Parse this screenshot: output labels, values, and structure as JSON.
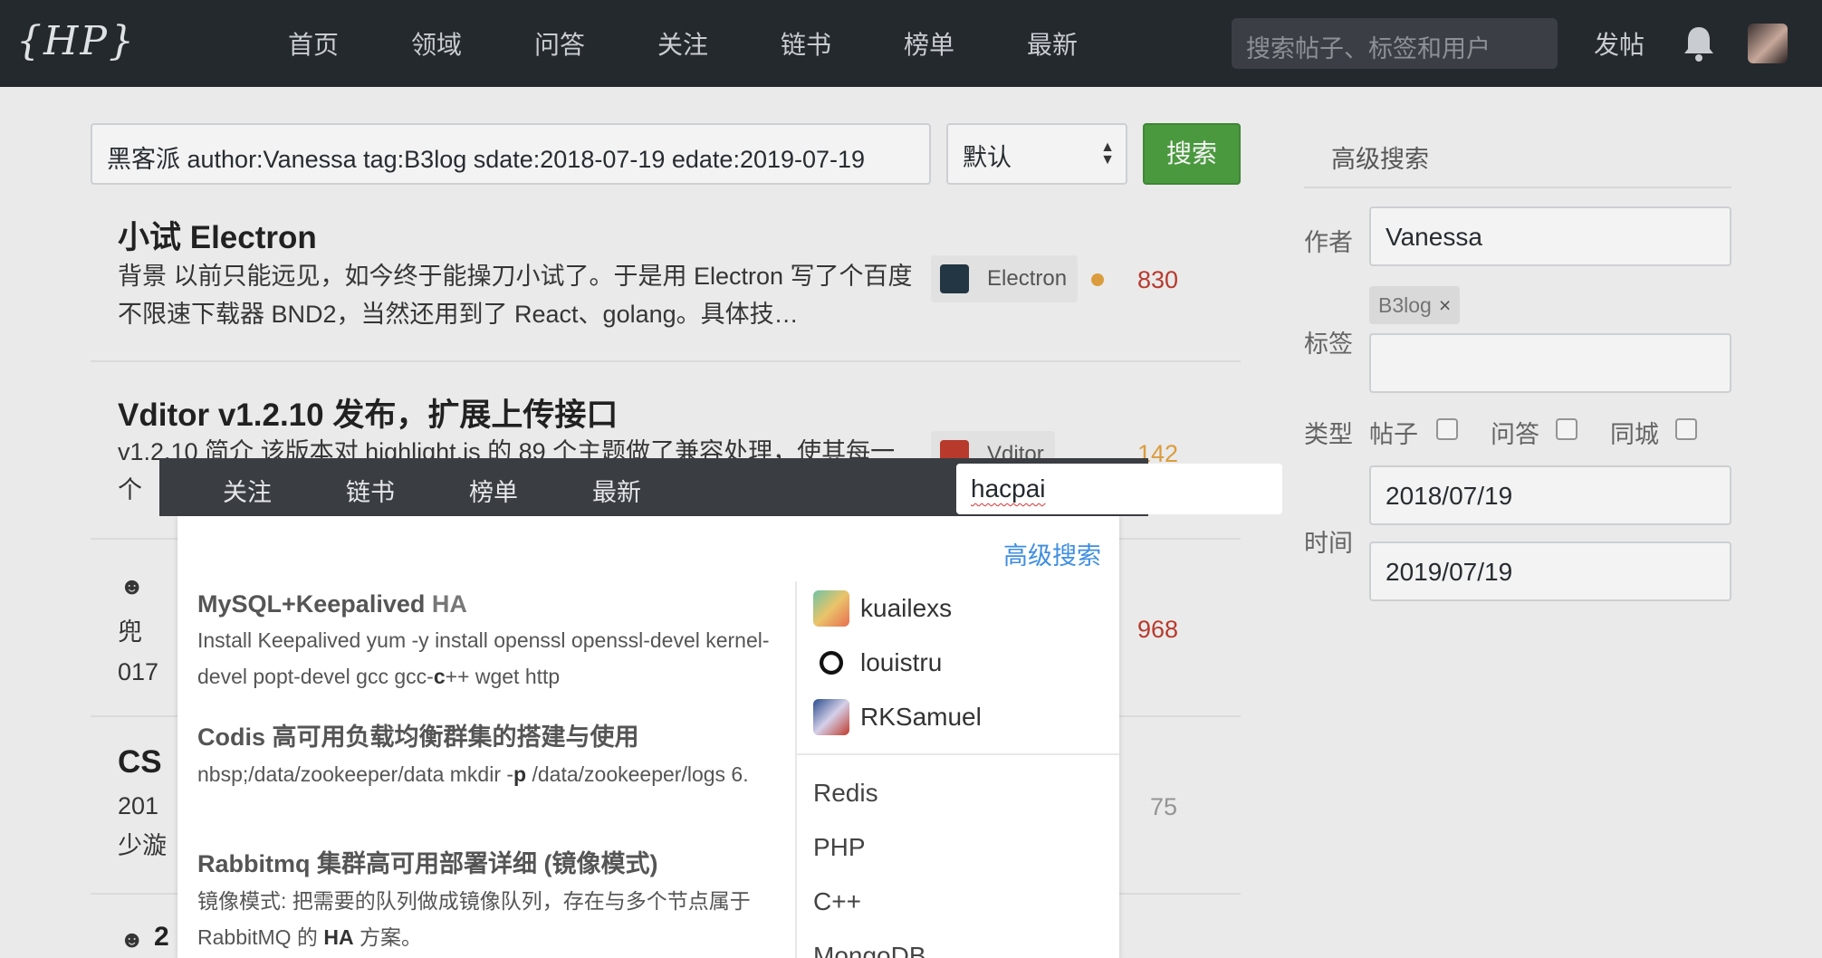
{
  "nav": {
    "logo": "{HP}",
    "links": [
      "首页",
      "领域",
      "问答",
      "关注",
      "链书",
      "榜单",
      "最新"
    ],
    "search_placeholder": "搜索帖子、标签和用户",
    "post_label": "发帖"
  },
  "search": {
    "query": "黑客派 author:Vanessa tag:B3log sdate:2018-07-19 edate:2019-07-19",
    "order": "默认",
    "button": "搜索"
  },
  "results": [
    {
      "title": "小试 Electron",
      "abstract": "背景 以前只能远见，如今终于能操刀小试了。于是用 Electron 写了个百度不限速下载器 BND2，当然还用到了 React、golang。具体技…",
      "tag": "Electron",
      "count": "830"
    },
    {
      "title": "Vditor v1.2.10 发布，扩展上传接口",
      "abstract": "v1.2.10 简介 该版本对 highlight.js 的 89 个主题做了兼容处理，使其每一个",
      "tag": "Vditor",
      "count": "142"
    }
  ],
  "ghost": {
    "r3_line1": "兜",
    "r3_line2": "017",
    "r3_count": "968",
    "r4_title": "CS",
    "r4_line1": "201",
    "r4_line2": "少漩",
    "r4_count": "75",
    "r5_title": "2"
  },
  "advanced": {
    "title": "高级搜索",
    "author_label": "作者",
    "author_value": "Vanessa",
    "tag_label": "标签",
    "tag_chip": "B3log",
    "tag_chip_close": "×",
    "type_label": "类型",
    "types": [
      "帖子",
      "问答",
      "同城"
    ],
    "time_label": "时间",
    "start_date": "2018/07/19",
    "end_date": "2019/07/19"
  },
  "popup": {
    "nav": [
      "关注",
      "链书",
      "榜单",
      "最新"
    ],
    "input_value": "hacpai",
    "advanced_link": "高级搜索",
    "results": [
      {
        "title_main": "MySQL+Keepalived ",
        "title_hl": "HA",
        "text_a": "Install Keepalived yum -y install openssl openssl-devel kernel-devel popt-devel gcc gcc-",
        "text_b": "c",
        "text_c": "++ wget http"
      },
      {
        "title_main": "Codis 高可用负载均衡群集的搭建与使用",
        "title_hl": "",
        "text_a": "nbsp;/data/zookeeper/data mkdir -",
        "text_b": "p",
        "text_c": " /data/zookeeper/logs 6."
      },
      {
        "title_main": "Rabbitmq 集群高可用部署详细 (镜像模式)",
        "title_hl": "",
        "text_a": "镜像模式: 把需要的队列做成镜像队列，存在与多个节点属于 RabbitMQ 的 ",
        "text_b": "HA",
        "text_c": " 方案。"
      }
    ],
    "users": [
      "kuailexs",
      "louistru",
      "RKSamuel"
    ],
    "tags": [
      "Redis",
      "PHP",
      "C++",
      "MongoDB"
    ]
  },
  "colors": {
    "nav_bg": "#24292e",
    "primary_green": "#4a9f3d",
    "link_blue": "#3e8ee0",
    "count_red": "#c0392b",
    "count_orange": "#e6a23c"
  }
}
